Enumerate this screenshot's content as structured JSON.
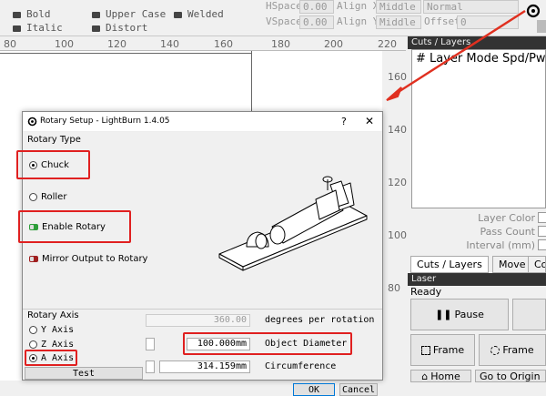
{
  "toolbar": {
    "bold": "Bold",
    "italic": "Italic",
    "upper_case": "Upper Case",
    "distort": "Distort",
    "welded": "Welded",
    "hspace_label": "HSpace",
    "hspace_value": "0.00",
    "vspace_label": "VSpace",
    "vspace_value": "0.00",
    "align_x_label": "Align X",
    "align_x_value": "Middle",
    "align_y_label": "Align Y",
    "align_y_value": "Middle",
    "mode_value": "Normal",
    "offset_label": "Offset",
    "offset_value": "0"
  },
  "ruler": {
    "top": [
      "80",
      "100",
      "120",
      "140",
      "160",
      "180",
      "200",
      "220"
    ],
    "right": [
      "160",
      "140",
      "120",
      "100",
      "80"
    ]
  },
  "cuts_panel": {
    "title": "Cuts / Layers",
    "header": "#  Layer Mode  Spd/Pwr",
    "layer_color": "Layer Color",
    "pass_count": "Pass Count",
    "interval": "Interval (mm)",
    "tabs": [
      "Cuts / Layers",
      "Move",
      "Con"
    ]
  },
  "laser_panel": {
    "title": "Laser",
    "status": "Ready",
    "pause": "Pause",
    "frame1": "Frame",
    "frame2": "Frame",
    "home": "Home",
    "go_to_origin": "Go to Origin"
  },
  "dialog": {
    "title": "Rotary Setup - LightBurn 1.4.05",
    "help": "?",
    "close": "✕",
    "rotary_type_label": "Rotary Type",
    "chuck": "Chuck",
    "roller": "Roller",
    "enable_rotary": "Enable Rotary",
    "mirror_output": "Mirror Output to Rotary",
    "rotary_axis_label": "Rotary Axis",
    "y_axis": "Y Axis",
    "z_axis": "Z Axis",
    "a_axis": "A Axis",
    "test": "Test",
    "degrees_value": "360.00",
    "degrees_label": "degrees per rotation",
    "diameter_value": "100.000mm",
    "diameter_label": "Object Diameter",
    "circumference_value": "314.159mm",
    "circumference_label": "Circumference",
    "ok": "OK",
    "cancel": "Cancel"
  },
  "colors": {
    "highlight": "#e02020",
    "toggle_on": "#2e9e3a",
    "toggle_off": "#a02020",
    "arrow": "#e03020"
  }
}
